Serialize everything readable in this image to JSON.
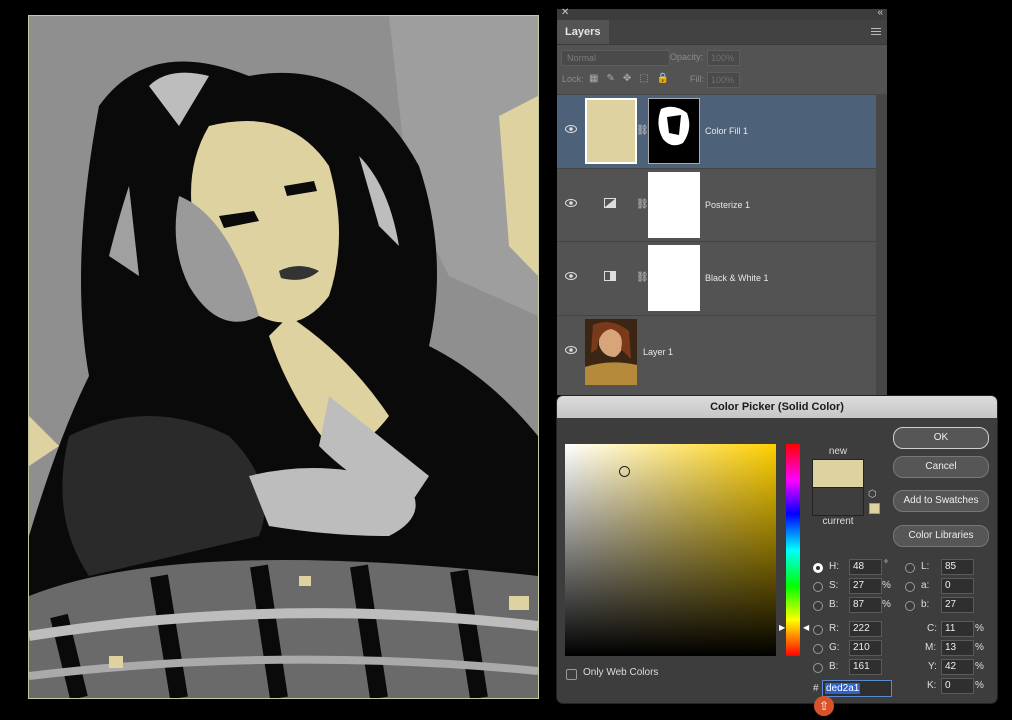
{
  "layers_panel": {
    "tab_label": "Layers",
    "blend_mode": "Normal",
    "opacity_label": "Opacity:",
    "opacity_value": "100%",
    "lock_label": "Lock:",
    "fill_label": "Fill:",
    "fill_value": "100%",
    "layers": [
      {
        "name": "Color Fill 1",
        "selected": true,
        "thumb_color": "#ded2a1"
      },
      {
        "name": "Posterize 1",
        "selected": false
      },
      {
        "name": "Black & White 1",
        "selected": false
      },
      {
        "name": "Layer 1",
        "selected": false
      }
    ]
  },
  "color_picker": {
    "title": "Color Picker (Solid Color)",
    "new_label": "new",
    "current_label": "current",
    "new_color": "#ded2a1",
    "buttons": {
      "ok": "OK",
      "cancel": "Cancel",
      "add_to_swatches": "Add to Swatches",
      "color_libraries": "Color Libraries"
    },
    "only_web_colors": "Only Web Colors",
    "hsb": {
      "H": "48",
      "S": "27",
      "B": "87"
    },
    "rgb": {
      "R": "222",
      "G": "210",
      "B": "161"
    },
    "lab": {
      "L": "85",
      "a": "0",
      "b": "27"
    },
    "cmyk": {
      "C": "11",
      "M": "13",
      "Y": "42",
      "K": "0"
    },
    "hex": "ded2a1",
    "hex_prefix": "#",
    "units": {
      "degree": "°",
      "percent": "%"
    }
  },
  "colors": {
    "accent_selection": "#4d6178",
    "hex_highlight": "#2e62c9",
    "shift_badge": "#d9532a"
  }
}
